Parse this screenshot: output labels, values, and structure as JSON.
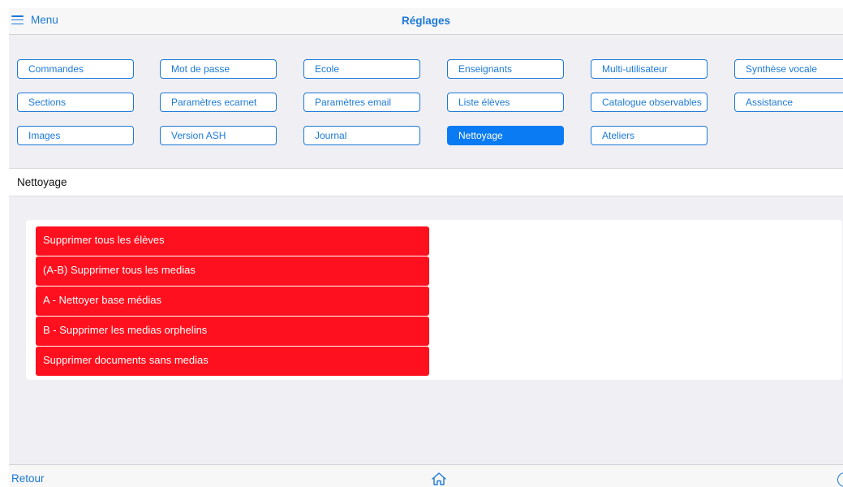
{
  "header": {
    "menu_label": "Menu",
    "title": "Réglages"
  },
  "tabs": [
    {
      "label": "Commandes",
      "active": false
    },
    {
      "label": "Mot de passe",
      "active": false
    },
    {
      "label": "Ecole",
      "active": false
    },
    {
      "label": "Enseignants",
      "active": false
    },
    {
      "label": "Multi-utilisateur",
      "active": false
    },
    {
      "label": "Synthèse vocale",
      "active": false
    },
    {
      "label": "Sections",
      "active": false
    },
    {
      "label": "Paramètres ecarnet",
      "active": false
    },
    {
      "label": "Paramètres email",
      "active": false
    },
    {
      "label": "Liste élèves",
      "active": false
    },
    {
      "label": "Catalogue observables",
      "active": false
    },
    {
      "label": "Assistance",
      "active": false
    },
    {
      "label": "Images",
      "active": false
    },
    {
      "label": "Version ASH",
      "active": false
    },
    {
      "label": "Journal",
      "active": false
    },
    {
      "label": "Nettoyage",
      "active": true
    },
    {
      "label": "Ateliers",
      "active": false
    }
  ],
  "section": {
    "title": "Nettoyage"
  },
  "actions": [
    "Supprimer tous les élèves",
    "(A-B) Supprimer tous les medias",
    "A - Nettoyer base médias",
    "B - Supprimer les medias orphelins",
    "Supprimer documents sans medias"
  ],
  "footer": {
    "back_label": "Retour",
    "home_icon": "home-icon"
  },
  "colors": {
    "accent": "#1c79d8",
    "active_tab": "#0a7bf2",
    "danger": "#ff101e",
    "background": "#efeff4"
  }
}
